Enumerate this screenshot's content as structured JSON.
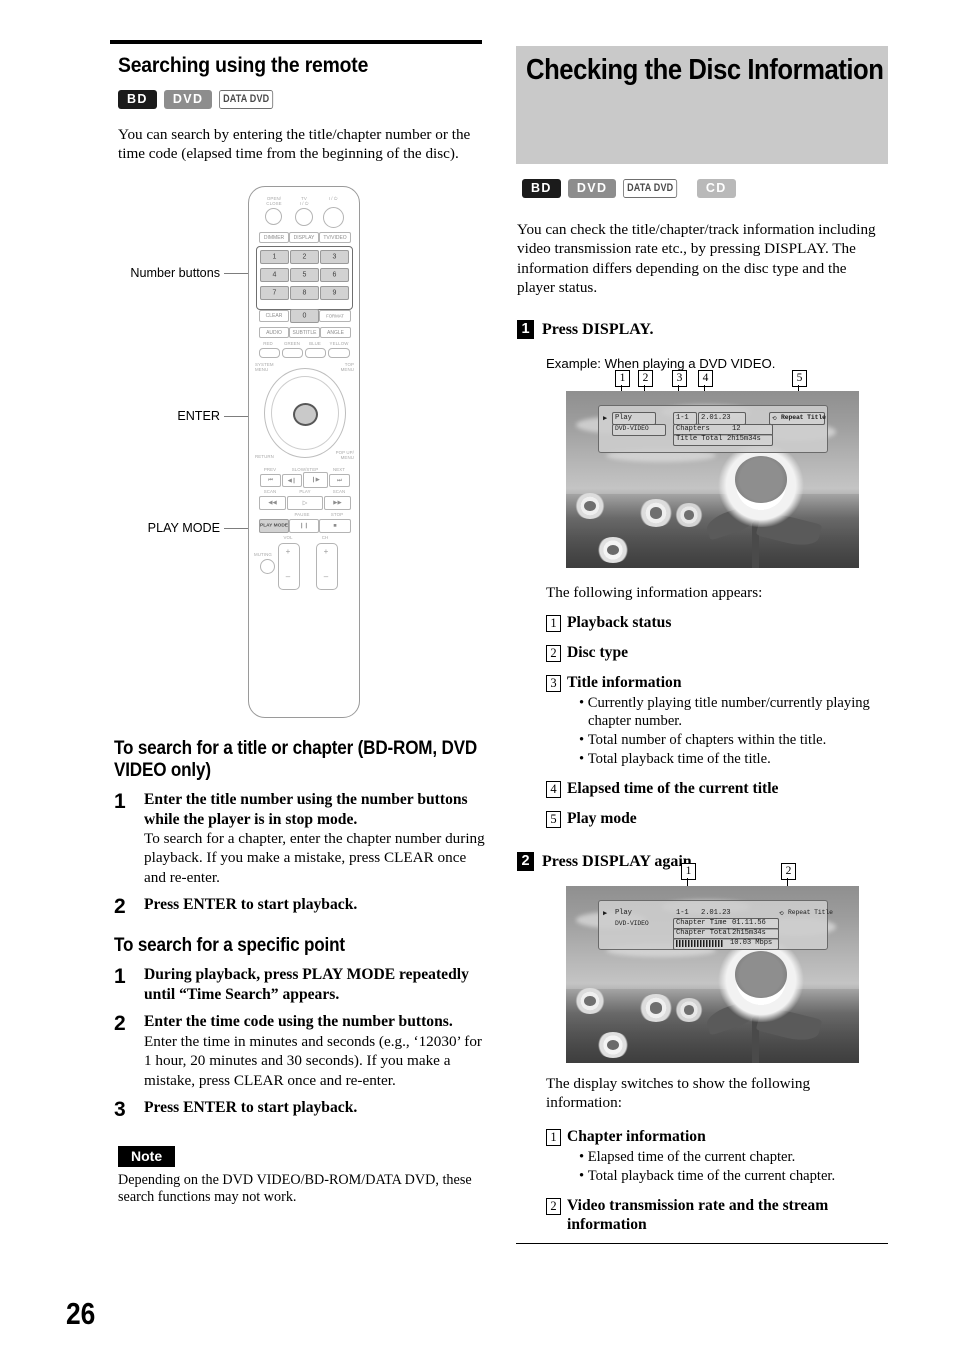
{
  "page": {
    "number": "26"
  },
  "left_column": {
    "heading": "Searching using the remote",
    "badges": [
      {
        "label": "BD",
        "style": "bd"
      },
      {
        "label": "DVD",
        "style": "dvd"
      },
      {
        "label": "DATA DVD",
        "style": "datadvd"
      }
    ],
    "intro": "You can search by entering the title/chapter number or the time code (elapsed time from the beginning of the disc).",
    "remote_callouts": [
      {
        "label": "Number buttons"
      },
      {
        "label": "ENTER"
      },
      {
        "label": "PLAY MODE"
      }
    ],
    "remote": {
      "top_labels": {
        "open_close": "OPEN/\nCLOSE",
        "tv_power": "TV\nI / ⏻",
        "power": "I / ⏻"
      },
      "row_dimmer": [
        "DIMMER",
        "DISPLAY",
        "TV/VIDEO"
      ],
      "number_keys": [
        "1",
        "2",
        "3",
        "4",
        "5",
        "6",
        "7",
        "8",
        "9"
      ],
      "zero_row": [
        "CLEAR",
        "0",
        "FORMAT"
      ],
      "av_row": [
        "AUDIO",
        "SUBTITLE",
        "ANGLE"
      ],
      "color_labels": [
        "RED",
        "GREEN",
        "BLUE",
        "YELLOW"
      ],
      "menu_labels": {
        "system_menu": "SYSTEM\nMENU",
        "top_menu": "TOP\nMENU",
        "return": "RETURN",
        "popup_menu": "POP UP/\nMENU"
      },
      "transport_labels": {
        "prev": "PREV",
        "slow_step": "SLOW/STEP",
        "next": "NEXT",
        "scan_left": "SCAN",
        "play": "PLAY",
        "scan_right": "SCAN",
        "pause": "PAUSE",
        "stop": "STOP"
      },
      "play_mode_btn": "PLAY MODE",
      "bottom_labels": {
        "vol": "VOL",
        "ch": "CH",
        "muting": "MUTING",
        "plus": "+",
        "minus": "–"
      }
    },
    "subheading_1": "To search for a title or chapter (BD-ROM, DVD VIDEO only)",
    "steps_1": [
      {
        "num": "1",
        "bold": "Enter the title number using the number buttons while the player is in stop mode.",
        "rest": "To search for a chapter, enter the chapter number during playback. If you make a mistake, press CLEAR once and re-enter."
      },
      {
        "num": "2",
        "bold": "Press ENTER to start playback.",
        "rest": ""
      }
    ],
    "subheading_2": "To search for a specific point",
    "steps_2": [
      {
        "num": "1",
        "bold": "During playback, press PLAY MODE repeatedly until “Time Search” appears.",
        "rest": ""
      },
      {
        "num": "2",
        "bold": "Enter the time code using the number buttons.",
        "rest": "Enter the time in minutes and seconds (e.g., ‘12030’ for 1 hour, 20 minutes and 30 seconds). If you make a mistake, press CLEAR once and re-enter."
      },
      {
        "num": "3",
        "bold": "Press ENTER to start playback.",
        "rest": ""
      }
    ],
    "note_tag": "Note",
    "note_text": "Depending on the DVD VIDEO/BD-ROM/DATA DVD, these search functions may not work."
  },
  "right_column": {
    "heading": "Checking the Disc Information",
    "badges": [
      {
        "label": "BD",
        "style": "bd"
      },
      {
        "label": "DVD",
        "style": "dvd"
      },
      {
        "label": "DATA DVD",
        "style": "datadvd"
      },
      {
        "label": "CD",
        "style": "cd"
      }
    ],
    "intro": "You can check the title/chapter/track information including video transmission rate etc., by pressing DISPLAY. The information differs depending on the disc type and the player status.",
    "step1": {
      "num": "1",
      "label": "Press DISPLAY."
    },
    "example_caption": "Example: When playing a DVD VIDEO.",
    "screen1": {
      "markers": [
        "1",
        "2",
        "3",
        "4",
        "5"
      ],
      "osd": {
        "status": "Play",
        "disc_type": "DVD-VIDEO",
        "title_chapter": "1-1",
        "elapsed": "2.01.23",
        "chapters_label": "Chapters",
        "chapters_value": "12",
        "total_label": "Title Total",
        "total_value": "2h15m34s",
        "play_mode": "Repeat Title"
      }
    },
    "following_text": "The following information appears:",
    "items1": [
      {
        "num": "1",
        "label": "Playback status",
        "bullets": []
      },
      {
        "num": "2",
        "label": "Disc type",
        "bullets": []
      },
      {
        "num": "3",
        "label": "Title information",
        "bullets": [
          "Currently playing title number/currently playing chapter number.",
          "Total number of chapters within the title.",
          "Total playback time of the title."
        ]
      },
      {
        "num": "4",
        "label": "Elapsed time of the current title",
        "bullets": []
      },
      {
        "num": "5",
        "label": "Play mode",
        "bullets": []
      }
    ],
    "step2": {
      "num": "2",
      "label": "Press DISPLAY again."
    },
    "screen2": {
      "markers": [
        "1",
        "2"
      ],
      "osd": {
        "status": "Play",
        "disc_type": "DVD-VIDEO",
        "title_chapter": "1-1",
        "elapsed": "2.01.23",
        "chapter_time_label": "Chapter Time",
        "chapter_time_value": "01.11.56",
        "chapter_total_label": "Chapter Total",
        "chapter_total_value": "2h15m34s",
        "bitrate_value": "10.03 Mbps",
        "play_mode": "Repeat Title"
      }
    },
    "switches_text": "The display switches to show the following information:",
    "items2": [
      {
        "num": "1",
        "label": "Chapter information",
        "bullets": [
          "Elapsed time of the current chapter.",
          "Total playback time of the current chapter."
        ]
      },
      {
        "num": "2",
        "label": "Video transmission rate and the stream information",
        "bullets": []
      }
    ]
  }
}
